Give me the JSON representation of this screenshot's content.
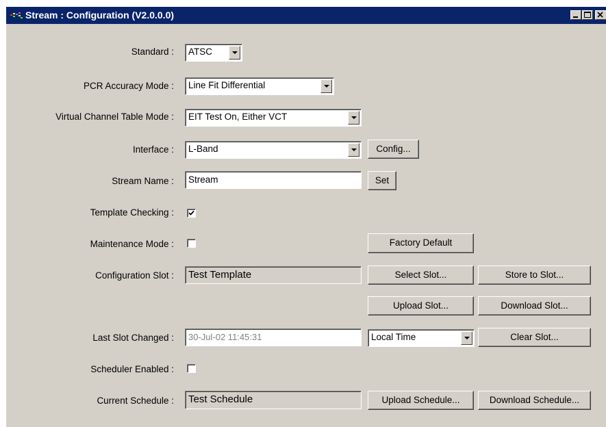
{
  "window": {
    "title": "Stream : Configuration (V2.0.0.0)"
  },
  "form": {
    "standard": {
      "label": "Standard :",
      "value": "ATSC"
    },
    "pcr_accuracy_mode": {
      "label": "PCR Accuracy Mode :",
      "value": "Line Fit Differential"
    },
    "vct_mode": {
      "label": "Virtual Channel Table Mode :",
      "value": "EIT Test On, Either VCT"
    },
    "interface": {
      "label": "Interface :",
      "value": "L-Band",
      "config_button": "Config..."
    },
    "stream_name": {
      "label": "Stream Name :",
      "value": "Stream",
      "set_button": "Set"
    },
    "template_checking": {
      "label": "Template Checking :",
      "checked": true
    },
    "maintenance_mode": {
      "label": "Maintenance Mode :",
      "checked": false,
      "factory_default_button": "Factory Default"
    },
    "configuration_slot": {
      "label": "Configuration Slot :",
      "value": "Test Template",
      "select_button": "Select Slot...",
      "store_button": "Store to Slot...",
      "upload_button": "Upload Slot...",
      "download_button": "Download Slot..."
    },
    "last_slot_changed": {
      "label": "Last Slot Changed :",
      "value": "30-Jul-02 11:45:31",
      "time_zone": "Local Time",
      "clear_button": "Clear Slot..."
    },
    "scheduler_enabled": {
      "label": "Scheduler Enabled :",
      "checked": false
    },
    "current_schedule": {
      "label": "Current Schedule :",
      "value": "Test Schedule",
      "upload_button": "Upload Schedule...",
      "download_button": "Download Schedule..."
    }
  }
}
